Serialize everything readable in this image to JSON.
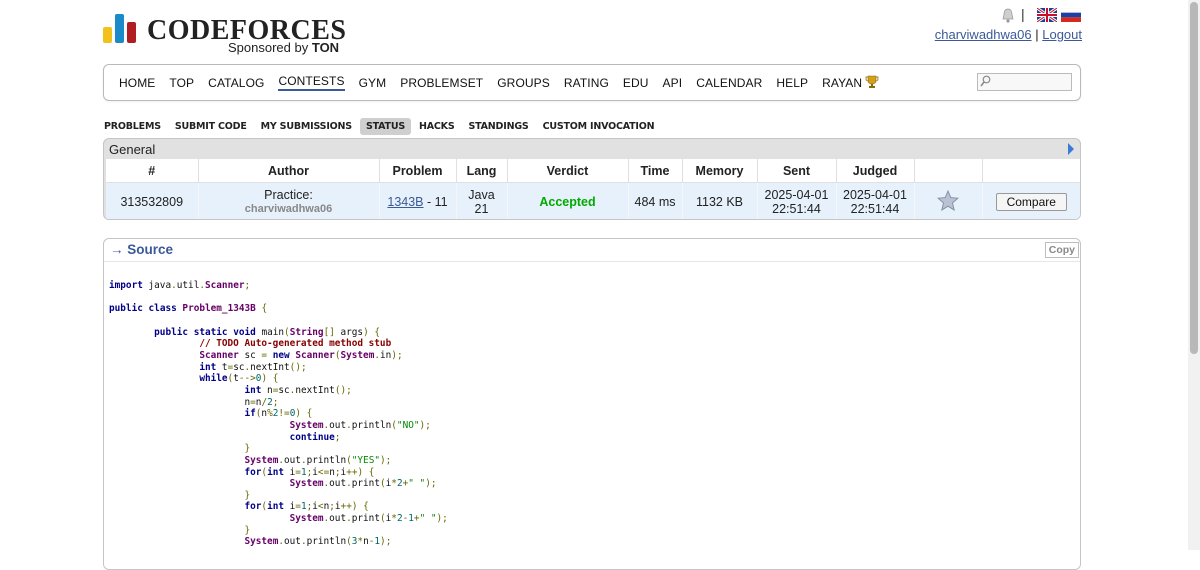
{
  "header": {
    "logo_text": "CODEFORCES",
    "sponsor_prefix": "Sponsored by",
    "sponsor_name": "TON",
    "lang_separator": "|",
    "user_handle": "charviwadhwa06",
    "user_separator": "|",
    "logout": "Logout"
  },
  "colors": {
    "logo_yellow": "#f2c11d",
    "logo_blue": "#1b8ac9",
    "logo_red": "#b11e22",
    "link": "#3b5998",
    "accepted": "#00aa00"
  },
  "nav": {
    "items": [
      "HOME",
      "TOP",
      "CATALOG",
      "CONTESTS",
      "GYM",
      "PROBLEMSET",
      "GROUPS",
      "RATING",
      "EDU",
      "API",
      "CALENDAR",
      "HELP",
      "RAYAN"
    ],
    "active": "CONTESTS",
    "search_placeholder": ""
  },
  "subnav": {
    "items": [
      "PROBLEMS",
      "SUBMIT CODE",
      "MY SUBMISSIONS",
      "STATUS",
      "HACKS",
      "STANDINGS",
      "CUSTOM INVOCATION"
    ],
    "selected": "STATUS"
  },
  "general": {
    "caption": "General",
    "columns": [
      "#",
      "Author",
      "Problem",
      "Lang",
      "Verdict",
      "Time",
      "Memory",
      "Sent",
      "Judged",
      "",
      ""
    ],
    "row": {
      "id": "313532809",
      "author_prefix": "Practice:",
      "author_handle": "charviwadhwa06",
      "problem_link": "1343B",
      "problem_suffix": " - 11",
      "lang": "Java 21",
      "verdict": "Accepted",
      "time": "484 ms",
      "memory": "1132 KB",
      "sent": "2025-04-01 22:51:44",
      "judged": "2025-04-01 22:51:44",
      "compare": "Compare"
    }
  },
  "source": {
    "title": "→ Source",
    "copy": "Copy",
    "code_lines": [
      "import java.util.Scanner;",
      "",
      "public class Problem_1343B {",
      "",
      "\tpublic static void main(String[] args) {",
      "\t\t// TODO Auto-generated method stub",
      "\t\tScanner sc = new Scanner(System.in);",
      "\t\tint t=sc.nextInt();",
      "\t\twhile(t-->0) {",
      "\t\t\tint n=sc.nextInt();",
      "\t\t\tn=n/2;",
      "\t\t\tif(n%2!=0) {",
      "\t\t\t\tSystem.out.println(\"NO\");",
      "\t\t\t\tcontinue;",
      "\t\t\t}",
      "\t\t\tSystem.out.println(\"YES\");",
      "\t\t\tfor(int i=1;i<=n;i++) {",
      "\t\t\t\tSystem.out.print(i*2+\" \");",
      "\t\t\t}",
      "\t\t\tfor(int i=1;i<n;i++) {",
      "\t\t\t\tSystem.out.print(i*2-1+\" \");",
      "\t\t\t}",
      "\t\t\tSystem.out.println(3*n-1);"
    ]
  }
}
